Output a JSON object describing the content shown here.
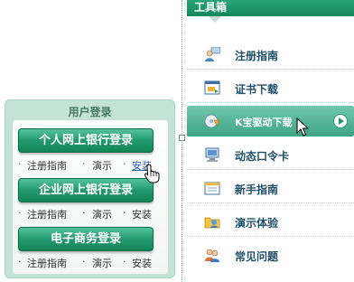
{
  "login": {
    "title": "用户登录",
    "groups": [
      {
        "button": "个人网上银行登录",
        "links": [
          "注册指南",
          "演示",
          "安装"
        ]
      },
      {
        "button": "企业网上银行登录",
        "links": [
          "注册指南",
          "演示",
          "安装"
        ]
      },
      {
        "button": "电子商务登录",
        "links": [
          "注册指南",
          "演示",
          "安装"
        ]
      }
    ]
  },
  "toolbox": {
    "title": "工具箱",
    "items": [
      {
        "label": "注册指南",
        "icon": "help-people-icon"
      },
      {
        "label": "证书下载",
        "icon": "certificate-window-icon"
      },
      {
        "label": "K宝驱动下载",
        "icon": "driver-disc-icon",
        "active": true
      },
      {
        "label": "动态口令卡",
        "icon": "token-computer-icon"
      },
      {
        "label": "新手指南",
        "icon": "calendar-guide-icon"
      },
      {
        "label": "演示体验",
        "icon": "demo-folder-icon"
      },
      {
        "label": "常见问题",
        "icon": "faq-people-icon"
      }
    ]
  },
  "colors": {
    "accent": "#1f9a6e",
    "link": "#1d4f6b",
    "panel": "#c2e3d5"
  }
}
